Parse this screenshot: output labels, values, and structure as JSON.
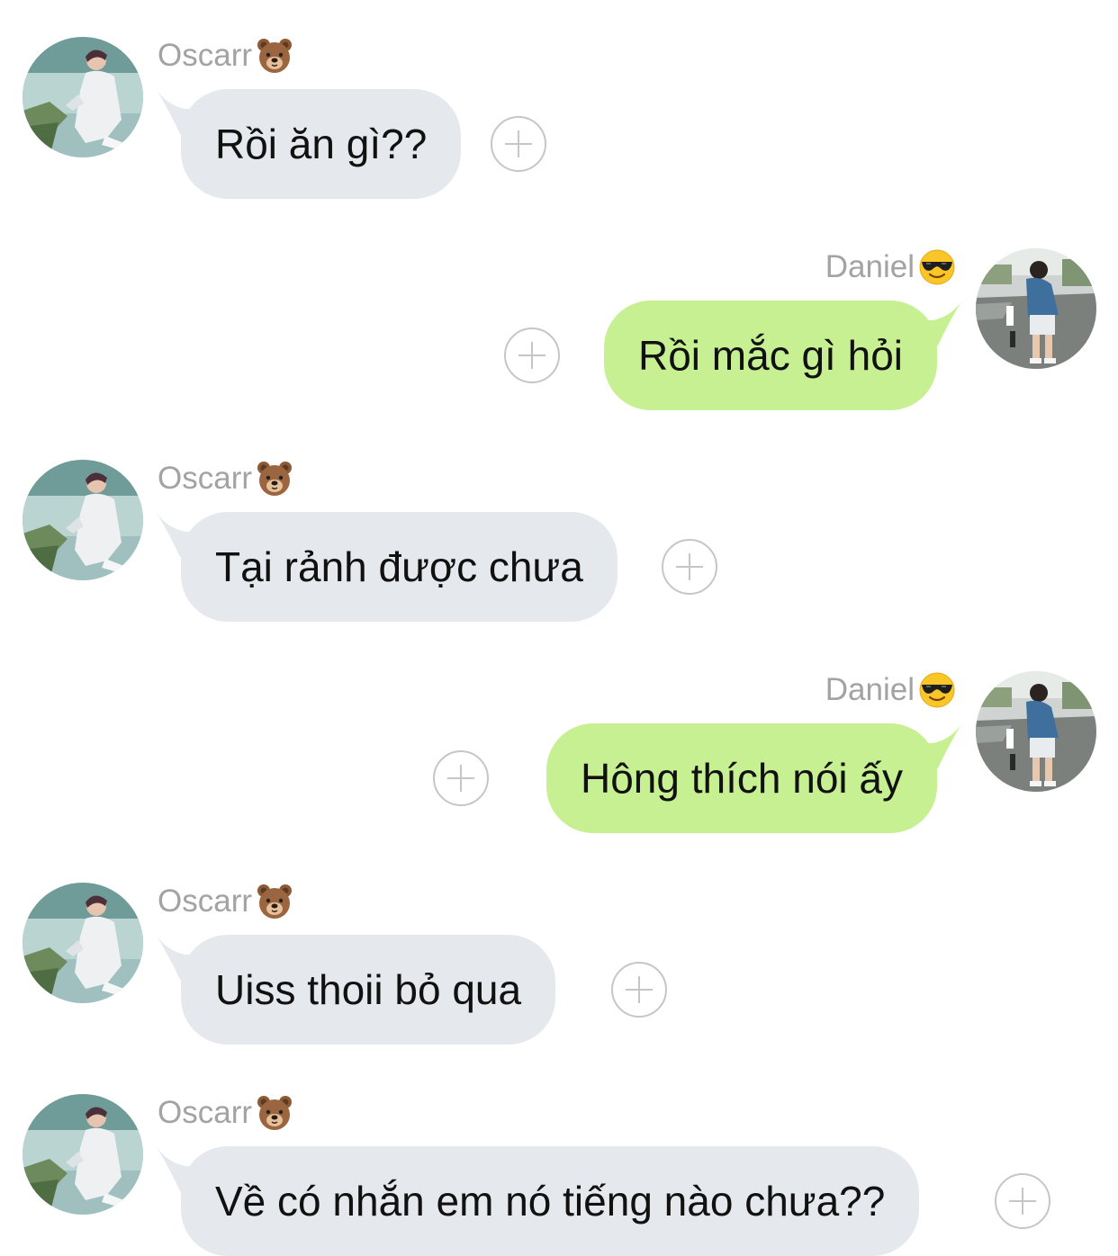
{
  "colors": {
    "incoming_bubble": "#e5e8ec",
    "outgoing_bubble": "#c7f092",
    "sender_name": "#a3a3a3",
    "react_icon": "#c6c6c6",
    "background": "#ffffff"
  },
  "messages": [
    {
      "direction": "incoming",
      "sender": "Oscarr",
      "sender_emoji": "bear-face-icon",
      "text": "Rồi ăn gì??"
    },
    {
      "direction": "outgoing",
      "sender": "Daniel",
      "sender_emoji": "sunglasses-face-icon",
      "text": "Rồi mắc gì hỏi"
    },
    {
      "direction": "incoming",
      "sender": "Oscarr",
      "sender_emoji": "bear-face-icon",
      "text": "Tại rảnh được chưa"
    },
    {
      "direction": "outgoing",
      "sender": "Daniel",
      "sender_emoji": "sunglasses-face-icon",
      "text": "Hông thích nói ấy"
    },
    {
      "direction": "incoming",
      "sender": "Oscarr",
      "sender_emoji": "bear-face-icon",
      "text": "Uiss thoii bỏ qua"
    },
    {
      "direction": "incoming",
      "sender": "Oscarr",
      "sender_emoji": "bear-face-icon",
      "text": "Về có nhắn em nó tiếng nào chưa??"
    }
  ]
}
